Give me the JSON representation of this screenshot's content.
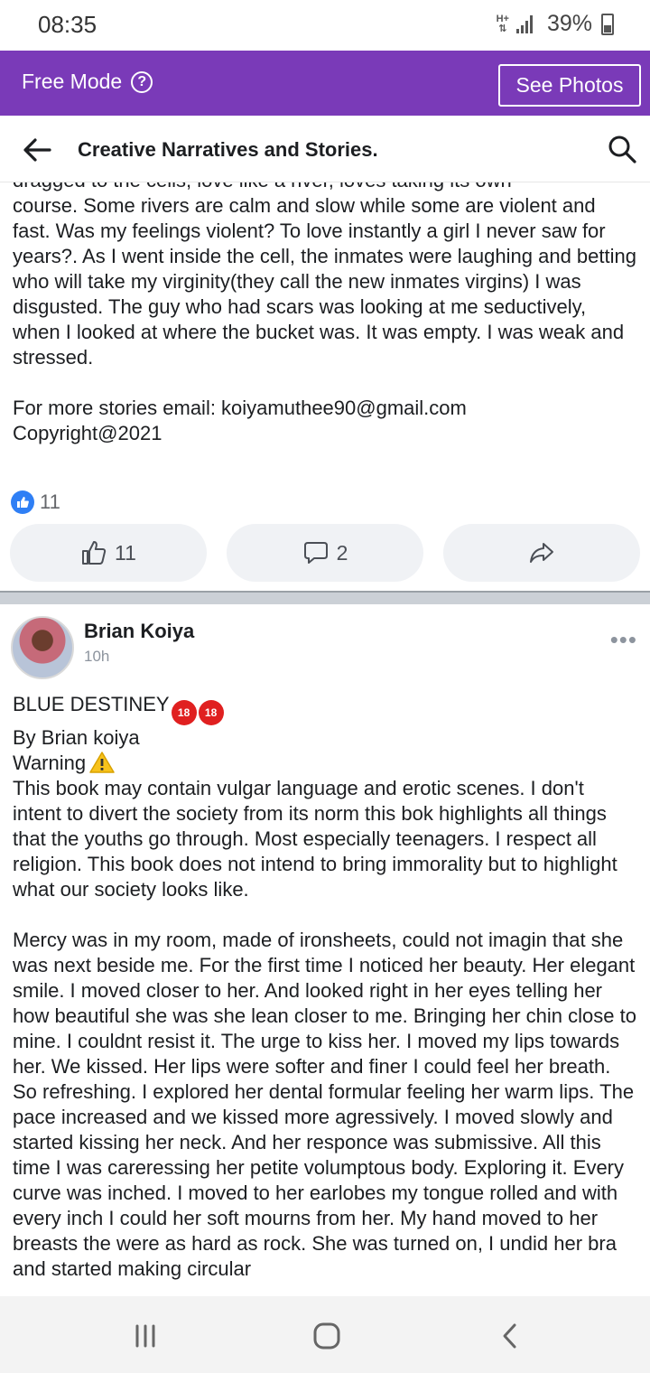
{
  "status": {
    "time": "08:35",
    "network": "H+",
    "battery": "39%"
  },
  "mode_bar": {
    "label": "Free Mode",
    "help_glyph": "?",
    "see_photos": "See Photos"
  },
  "header": {
    "title": "Creative Narratives and Stories."
  },
  "post1": {
    "cut_line": "dragged to the cells, love like a river, loves taking its own",
    "body": "course. Some rivers are calm and slow while some are violent and fast. Was my feelings violent? To love instantly a girl I never saw for years?. As I went inside the cell, the inmates were laughing and betting who will take my virginity(they call the new inmates virgins) I was disgusted. The guy who had scars was looking at me seductively, when I looked at where the bucket was. It was empty. I was weak and stressed.\n\nFor more stories email: koiyamuthee90@gmail.com\nCopyright@2021",
    "reaction_count": "11",
    "like_count": "11",
    "comment_count": "2"
  },
  "post2": {
    "author": "Brian Koiya",
    "time": "10h",
    "more": "•••",
    "title": "BLUE DESTINEY",
    "emoji_label": "18",
    "byline": "By Brian koiya",
    "warning": "Warning",
    "paragraph1": "This book may contain vulgar language and erotic scenes. I don't intent to divert the society from its norm this bok highlights all things that the youths go through. Most especially teenagers. I respect all religion. This book does not intend to bring immorality but to highlight what our society looks like.",
    "paragraph2": "Mercy was in my room, made of ironsheets, could not imagin that she was next beside me. For the first time I noticed her beauty. Her elegant smile. I moved closer to her. And looked right in her eyes telling her how beautiful she was she lean closer to me. Bringing her chin close to mine. I couldnt resist it. The urge to kiss her. I moved my lips towards her. We kissed. Her lips were softer and finer I could feel her breath. So refreshing. I explored her dental formular feeling her warm lips. The pace increased and we kissed more agressively. I moved slowly and started kissing her neck. And her responce was submissive. All this time I was careressing her petite volumptous body. Exploring it. Every curve was inched. I moved to her earlobes my tongue rolled and with every inch I could her soft mourns from her. My hand moved to her breasts the were as hard as rock. She was turned on, I undid her bra and started making circular"
  },
  "icons": {
    "back": "arrow-left",
    "search": "magnifier",
    "like": "thumbs-up",
    "comment": "speech-bubble",
    "share": "share-arrow",
    "nav_recent": "three-bars",
    "nav_home": "rounded-square",
    "nav_back": "chevron-left"
  },
  "colors": {
    "mode_bar": "#7a3ab8",
    "like_blue": "#2f7ff5",
    "button_bg": "#f0f2f5"
  }
}
